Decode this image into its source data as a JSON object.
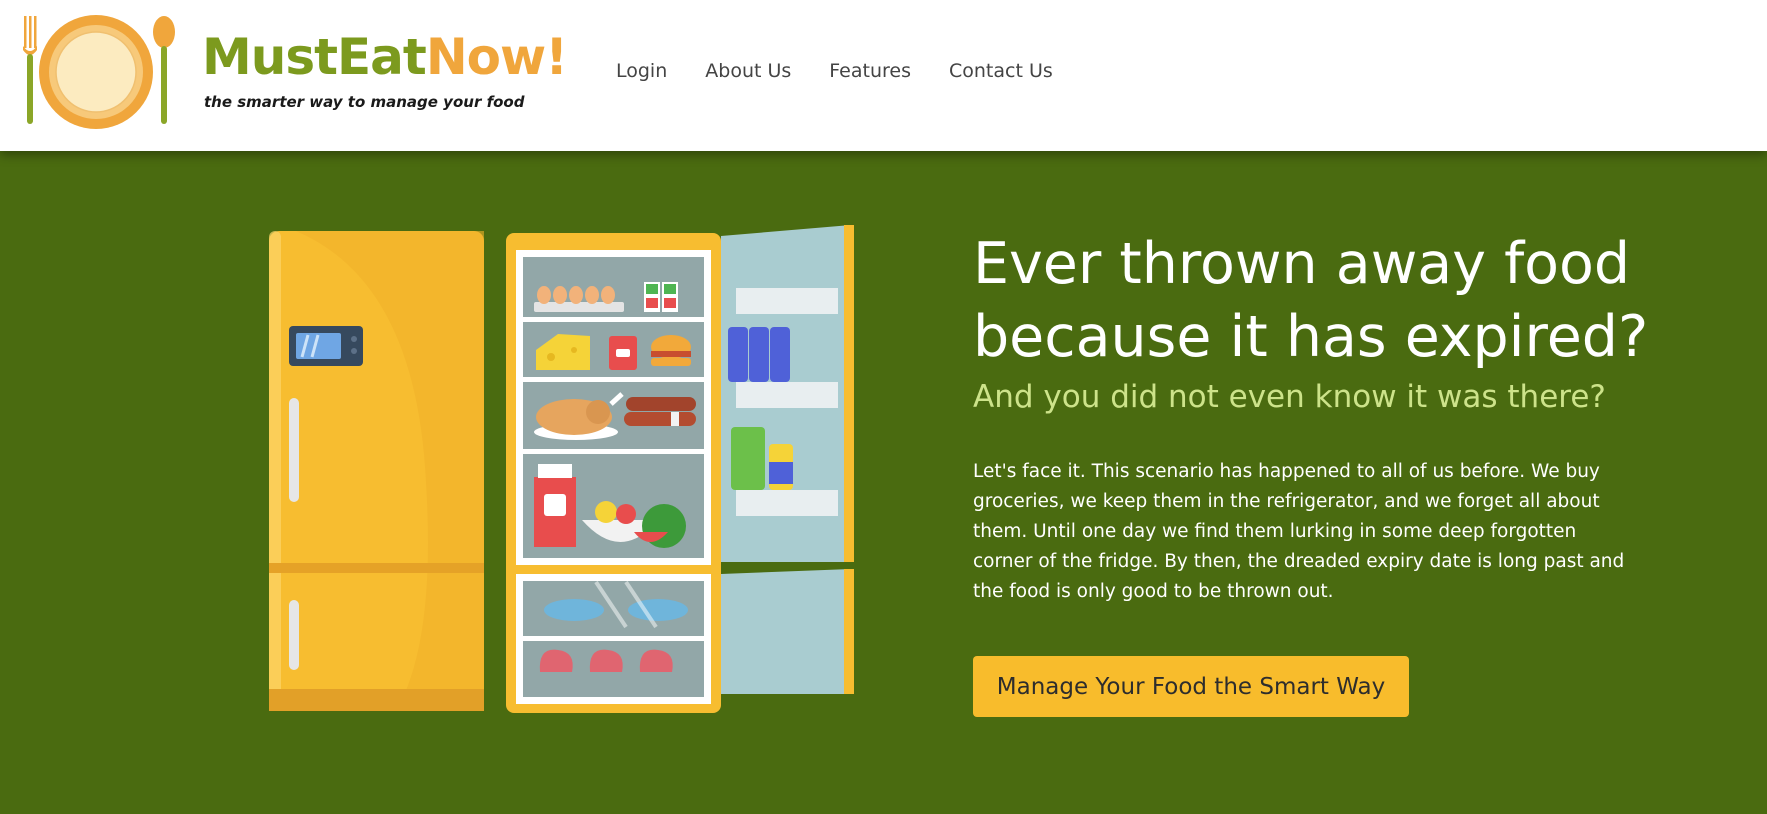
{
  "brand": {
    "name_part1": "MustEat",
    "name_part2": "Now!",
    "tagline": "the smarter way to manage your food",
    "colors": {
      "green": "#7c9a1e",
      "orange": "#f0a63c"
    },
    "icons": [
      "fork-icon",
      "plate-icon",
      "spoon-icon"
    ]
  },
  "nav": {
    "items": [
      {
        "label": "Login"
      },
      {
        "label": "About Us"
      },
      {
        "label": "Features"
      },
      {
        "label": "Contact Us"
      }
    ]
  },
  "hero": {
    "title": "Ever thrown away food because it has expired?",
    "subtitle": "And you did not even know it was there?",
    "body": "Let's face it. This scenario has happened to all of us before. We buy groceries, we keep them in the refrigerator, and we forget all about them. Until one day we find them lurking in some deep forgotten corner of the fridge. By then, the dreaded expiry date is long past and the food is only good to be thrown out.",
    "cta_label": "Manage Your Food the Smart Way",
    "illustration": "open-refrigerator-illustration",
    "colors": {
      "background": "#4a6b10",
      "subtitle": "#cde38a",
      "cta": "#f8bc2c"
    }
  }
}
